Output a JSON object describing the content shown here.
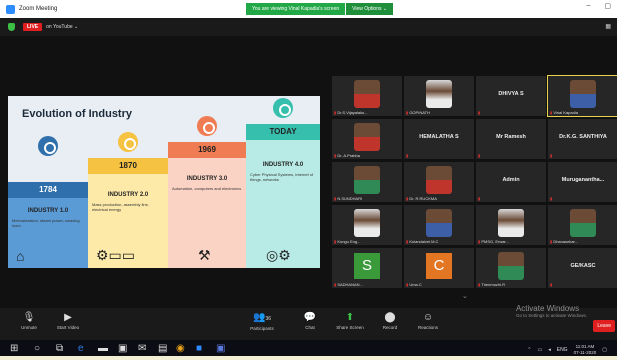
{
  "window": {
    "title": "Zoom Meeting",
    "viewing_banner": "You are viewing Vinal Kapadia's screen",
    "view_options": "View Options ⌄",
    "controls": [
      "–",
      "▢"
    ]
  },
  "livebar": {
    "live": "LIVE",
    "platform": "on YouTube ⌄",
    "grid_glyph": "▦"
  },
  "slide": {
    "title": "Evolution of Industry",
    "steps": [
      {
        "year": "1784",
        "name": "INDUSTRY 1.0",
        "desc": "Mechanization, steam power, weaving loom",
        "color": "#2f6fab"
      },
      {
        "year": "1870",
        "name": "INDUSTRY 2.0",
        "desc": "Mass production, assembly line, electrical energy",
        "color": "#f5c242"
      },
      {
        "year": "1969",
        "name": "INDUSTRY 3.0",
        "desc": "Automation, computers and electronics",
        "color": "#ef7c52"
      },
      {
        "year": "TODAY",
        "name": "INDUSTRY 4.0",
        "desc": "Cyber Physical Systems, internet of things, networks",
        "color": "#37bfae"
      }
    ]
  },
  "gallery": {
    "tiles": [
      {
        "name": "Dr.S.Vijayalaks...",
        "big": "",
        "kind": "face",
        "style": "red"
      },
      {
        "name": "GOPINATH",
        "big": "",
        "kind": "face",
        "style": "light"
      },
      {
        "name": "",
        "big": "DHIVYA S",
        "kind": "name"
      },
      {
        "name": "Vinal Kapadia",
        "big": "",
        "kind": "face",
        "style": "shirtblue",
        "active": true
      },
      {
        "name": "Dr. A.Prabha",
        "big": "",
        "kind": "face",
        "style": "red"
      },
      {
        "name": "",
        "big": "HEMALATHA S",
        "kind": "name"
      },
      {
        "name": "",
        "big": "Mr Ramesh",
        "kind": "name"
      },
      {
        "name": "",
        "big": "Dr.K.G. SANTHIYA",
        "kind": "name"
      },
      {
        "name": "N.SUNDHARI",
        "big": "",
        "kind": "face",
        "style": "grn"
      },
      {
        "name": "Dr. R.RUCKMA",
        "big": "",
        "kind": "face",
        "style": "red"
      },
      {
        "name": "",
        "big": "Admin",
        "kind": "name"
      },
      {
        "name": "",
        "big": "Muruganantha...",
        "kind": "name"
      },
      {
        "name": "Kongu Eng...",
        "big": "",
        "kind": "face",
        "style": "light"
      },
      {
        "name": "Kulandaivel.M.C",
        "big": "",
        "kind": "face",
        "style": "shirtblue"
      },
      {
        "name": "PMSG, Erwar...",
        "big": "",
        "kind": "face",
        "style": "light"
      },
      {
        "name": "Dhanasekar...",
        "big": "",
        "kind": "face",
        "style": "grn"
      },
      {
        "name": "SADHANAN...",
        "big": "",
        "kind": "letter",
        "letter": "S",
        "bg": "#3a9a3a"
      },
      {
        "name": "Uma.C",
        "big": "",
        "kind": "letter",
        "letter": "C",
        "bg": "#e27622"
      },
      {
        "name": "Thenmozhi.R",
        "big": "",
        "kind": "face",
        "style": "grn"
      },
      {
        "name": "",
        "big": "GE/KASC",
        "kind": "name"
      }
    ]
  },
  "toolbar": {
    "unmute": "Unmute",
    "start_video": "Start Video",
    "participants": "Participants",
    "participants_count": "36",
    "chat": "Chat",
    "share_screen": "Share Screen",
    "record": "Record",
    "reactions": "Reactions",
    "leave": "Leave",
    "activate_title": "Activate Windows",
    "activate_sub": "Go to Settings to activate Windows."
  },
  "taskbar": {
    "lang": "ENG",
    "time": "11:01 AM",
    "date": "07-11-2020"
  }
}
